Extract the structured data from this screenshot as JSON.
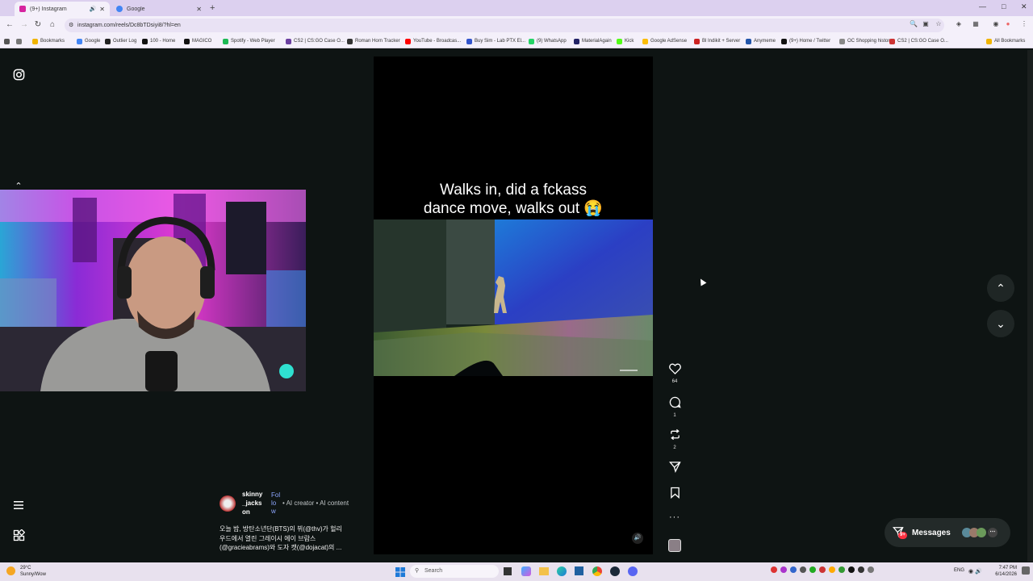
{
  "browser": {
    "tabs": [
      {
        "title": "(9+) Instagram",
        "active": true,
        "favicon_color": "#d6249f"
      },
      {
        "title": "Google",
        "active": false,
        "favicon_color": "#4285f4"
      }
    ],
    "new_tab": "+",
    "url": "instagram.com/reels/Dc8bTDsiyi8/?hl=en",
    "bookmarks": [
      {
        "label": "Bookmarks",
        "color": "#f0b400"
      },
      {
        "label": "Google",
        "color": "#4285f4"
      },
      {
        "label": "Outlier Log",
        "color": "#222222"
      },
      {
        "label": "100 - Home",
        "color": "#111111"
      },
      {
        "label": "MAGICO",
        "color": "#111111"
      },
      {
        "label": "Spotify - Web Player",
        "color": "#1db954"
      },
      {
        "label": "CS2 | CS:GO Case O...",
        "color": "#6b3fa0"
      },
      {
        "label": "Roman Horn Tracker",
        "color": "#333333"
      },
      {
        "label": "YouTube - Broadcas...",
        "color": "#ff0000"
      },
      {
        "label": "Buy Sim - Lab PTX El...",
        "color": "#3355cc"
      },
      {
        "label": "(9) WhatsApp",
        "color": "#25d366"
      },
      {
        "label": "MaterialAgain",
        "color": "#222266"
      },
      {
        "label": "Kick",
        "color": "#53fc18"
      },
      {
        "label": "Google AdSense",
        "color": "#fbbc05"
      },
      {
        "label": "Bl Indikit + Server",
        "color": "#cc2222"
      },
      {
        "label": "Anymeme",
        "color": "#2255aa"
      },
      {
        "label": "(9+) Home / Twitter",
        "color": "#111111"
      },
      {
        "label": "OC Shopping history",
        "color": "#888888"
      },
      {
        "label": "CS2 | CS:GO Case O...",
        "color": "#cc3333"
      }
    ],
    "all_bookmarks": "All Bookmarks"
  },
  "reel": {
    "caption_line1": "Walks in, did a fckass",
    "caption_line2": "dance move, walks out 😭",
    "likes": "64",
    "comments": "1",
    "reposts": "2",
    "author_line1": "skinny",
    "author_line2": "_jacks",
    "author_line3": "on",
    "follow_1": "Fol",
    "follow_2": "lo",
    "follow_3": "w",
    "author_meta": "• AI creator • AI content",
    "description_line1": "오늘 밤, 방탄소년단(BTS)의 뷔(@thv)가 헐리",
    "description_line2": "우드에서 열린 그레이시 에이 브람스",
    "description_line3": "(@gracieabrams)와 도자 캣(@dojacat)의 ..."
  },
  "messages": {
    "label": "Messages",
    "badge": "9+"
  },
  "taskbar": {
    "weather_temp": "29°C",
    "weather_desc": "Sunny/Wow",
    "search": "Search",
    "lang": "ENG",
    "time": "7:47 PM",
    "date": "6/14/2026"
  },
  "colors": {
    "accent_blue": "#8ea7ff",
    "page_bg": "#0e1413",
    "badge_red": "#ff3040"
  }
}
